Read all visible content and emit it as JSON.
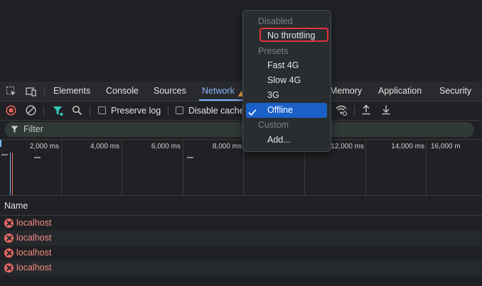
{
  "tabs": [
    {
      "label": "Elements"
    },
    {
      "label": "Console"
    },
    {
      "label": "Sources"
    },
    {
      "label": "Network",
      "active": true
    },
    {
      "label": "Memory"
    },
    {
      "label": "Application"
    },
    {
      "label": "Security"
    }
  ],
  "toolbar": {
    "preserve_log_label": "Preserve log",
    "disable_cache_label": "Disable cache"
  },
  "filter": {
    "placeholder": "Filter"
  },
  "timeline": {
    "ticks": [
      "2,000 ms",
      "4,000 ms",
      "6,000 ms",
      "8,000 ms",
      "12,000 ms",
      "14,000 ms",
      "16,000 m"
    ]
  },
  "table": {
    "name_header": "Name",
    "rows": [
      "localhost",
      "localhost",
      "localhost",
      "localhost"
    ]
  },
  "throttle_menu": {
    "items": [
      {
        "label": "Disabled",
        "kind": "header"
      },
      {
        "label": "No throttling",
        "kind": "item",
        "highlighted": true
      },
      {
        "label": "Presets",
        "kind": "header"
      },
      {
        "label": "Fast 4G",
        "kind": "item"
      },
      {
        "label": "Slow 4G",
        "kind": "item"
      },
      {
        "label": "3G",
        "kind": "item"
      },
      {
        "label": "Offline",
        "kind": "item",
        "selected": true
      },
      {
        "label": "Custom",
        "kind": "header"
      },
      {
        "label": "Add...",
        "kind": "item"
      }
    ]
  },
  "colors": {
    "accent": "#8ab4f8",
    "error": "#f28b82",
    "selection": "#1a60c8",
    "highlight_box": "#e1323a"
  }
}
